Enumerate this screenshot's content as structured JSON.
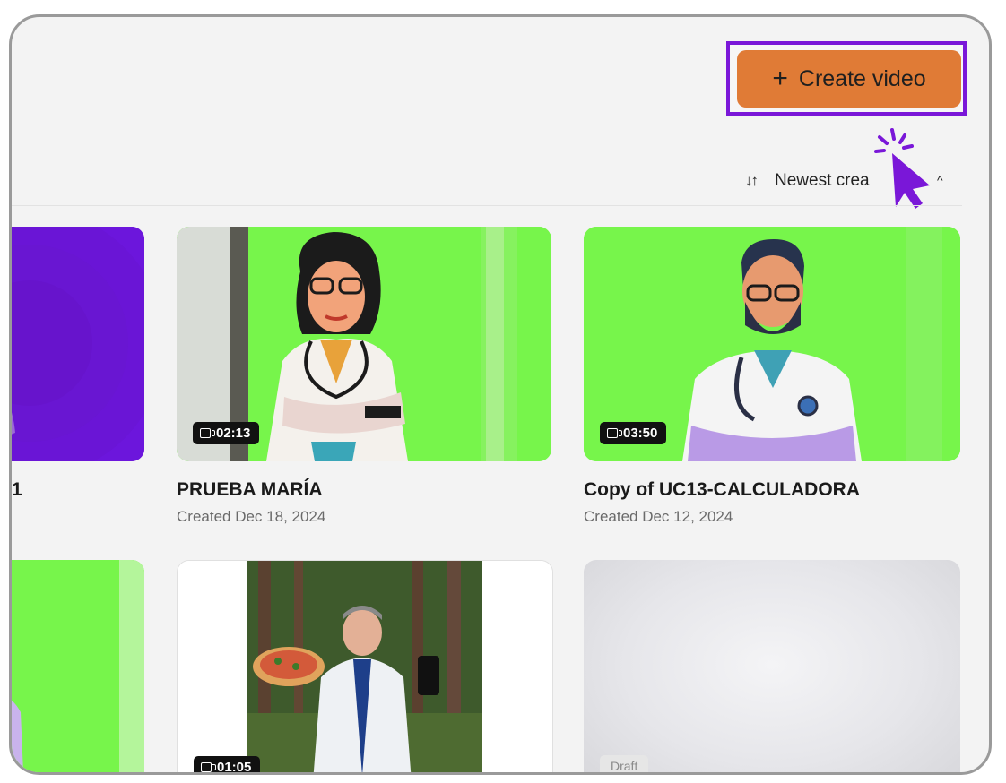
{
  "header": {
    "create_button_label": "Create video",
    "create_button_icon": "plus-icon",
    "accent_color": "#e07b36",
    "highlight_color": "#7a17d8"
  },
  "sort": {
    "label": "Newest crea",
    "icon": "sort-arrows-icon"
  },
  "videos": [
    {
      "title": "1",
      "date": "",
      "duration": ""
    },
    {
      "title": "PRUEBA MARÍA",
      "date": "Created Dec 18, 2024",
      "duration": "02:13"
    },
    {
      "title": "Copy of UC13-CALCULADORA",
      "date": "Created Dec 12, 2024",
      "duration": "03:50"
    },
    {
      "title": "",
      "date": "",
      "duration": ""
    },
    {
      "title": "",
      "date": "",
      "duration": "01:05"
    },
    {
      "title": "",
      "date": "",
      "duration": "",
      "status": "Draft"
    }
  ]
}
